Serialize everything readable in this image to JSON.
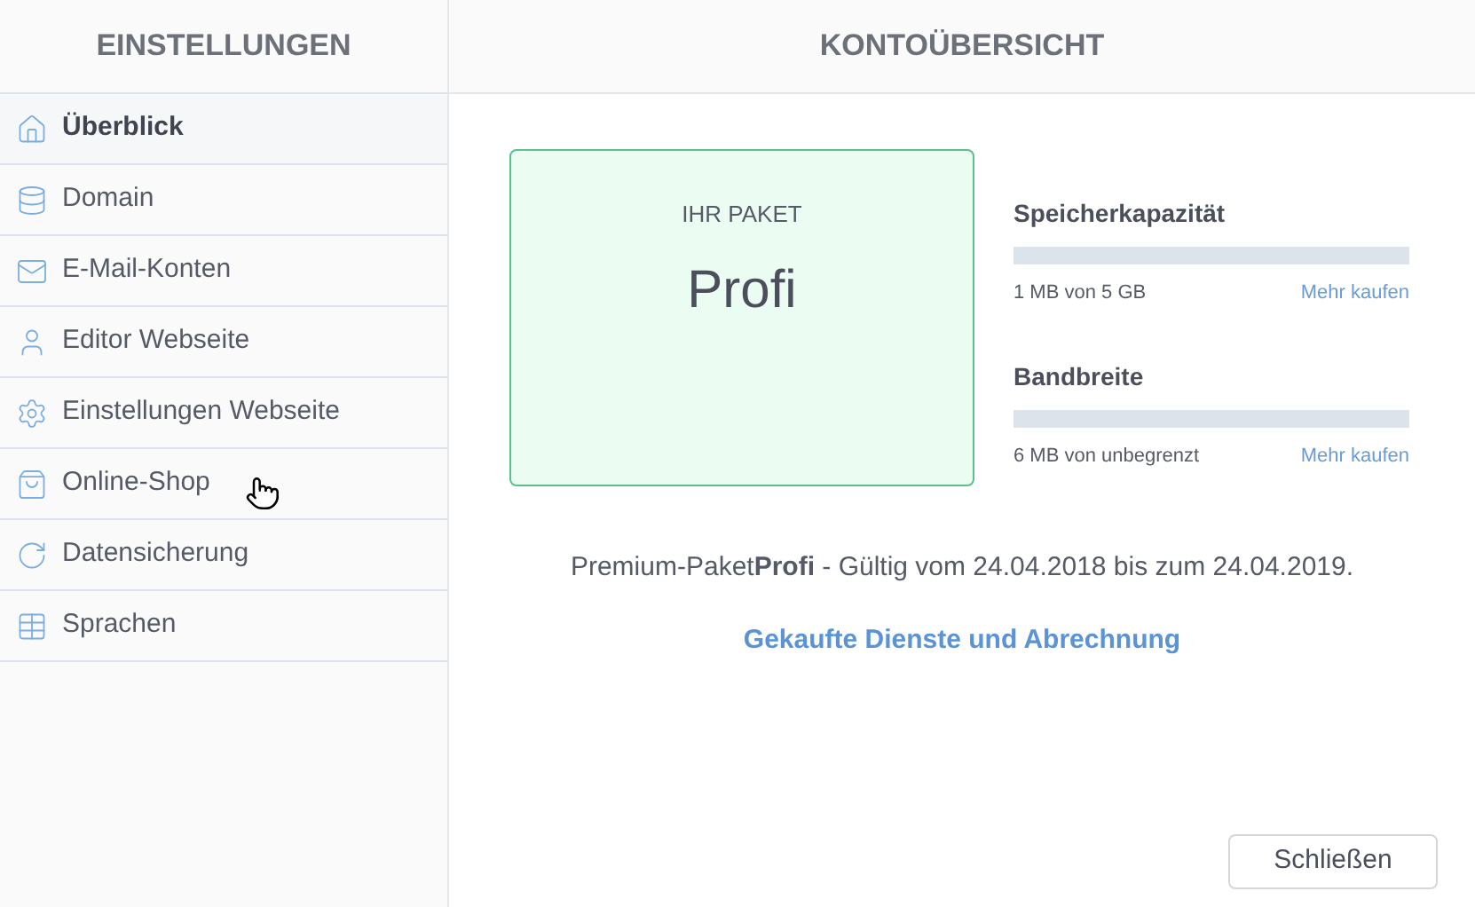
{
  "sidebar": {
    "title": "EINSTELLUNGEN",
    "items": [
      {
        "label": "Überblick",
        "selected": true
      },
      {
        "label": "Domain",
        "selected": false
      },
      {
        "label": "E-Mail-Konten",
        "selected": false
      },
      {
        "label": "Editor Webseite",
        "selected": false
      },
      {
        "label": "Einstellungen Webseite",
        "selected": false
      },
      {
        "label": "Online-Shop",
        "selected": false
      },
      {
        "label": "Datensicherung",
        "selected": false
      },
      {
        "label": "Sprachen",
        "selected": false
      }
    ]
  },
  "main": {
    "title": "KONTOÜBERSICHT",
    "package": {
      "label": "IHR PAKET",
      "name": "Profi"
    },
    "meters": [
      {
        "title": "Speicherkapazität",
        "level": 0,
        "reading": "1 MB von 5 GB",
        "link": "Mehr kaufen"
      },
      {
        "title": "Bandbreite",
        "level": 0,
        "reading": "6 MB von unbegrenzt",
        "link": "Mehr kaufen"
      }
    ],
    "validity": "Premium-Paket**Profi** - Gültig vom 24.04.2018 bis zum 24.04.2019.",
    "billing_link": "Gekaufte Dienste und Abrechnung",
    "close_button": "Schließen"
  }
}
